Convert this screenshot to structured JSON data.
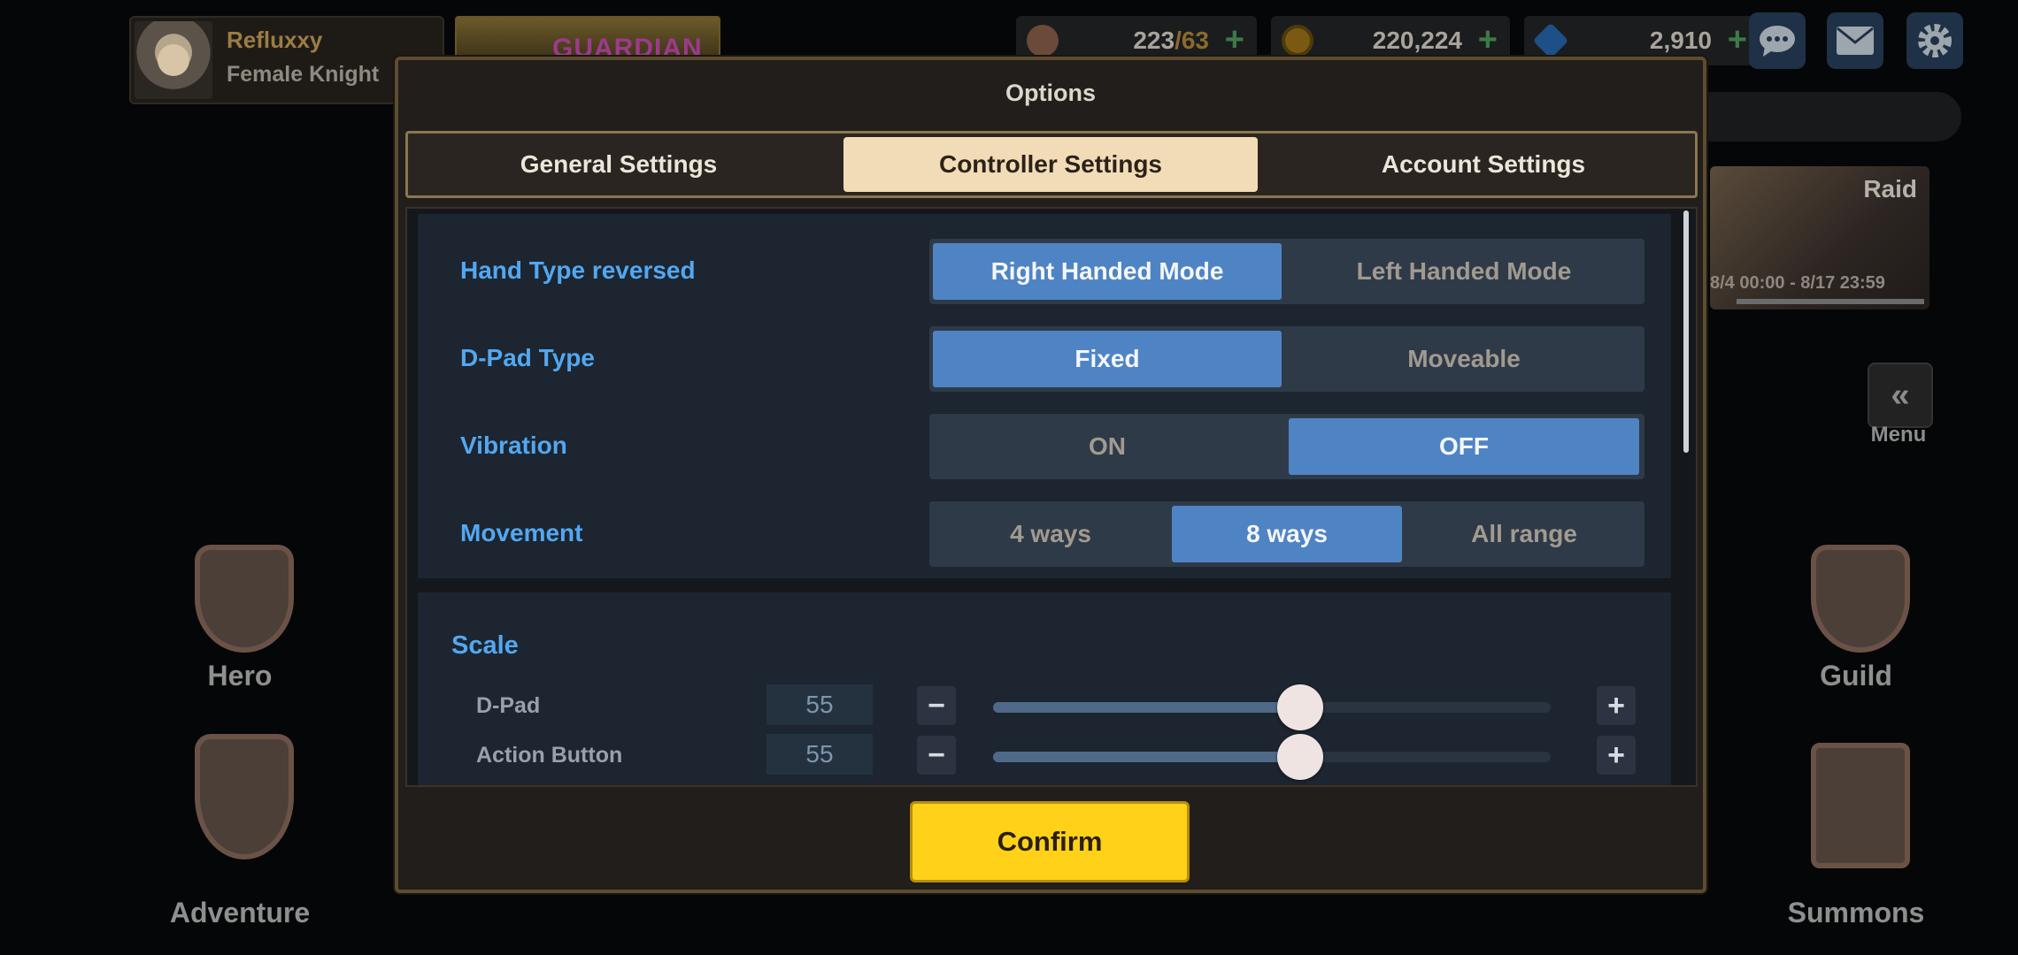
{
  "profile": {
    "name": "Refluxxy",
    "class": "Female Knight"
  },
  "banner": {
    "text": "GUARDIAN"
  },
  "resources": {
    "stamina": {
      "current": "223",
      "max": "/63",
      "icon": "coffee-cup-icon"
    },
    "gold": {
      "value": "220,224",
      "icon": "gold-coin-icon"
    },
    "gems": {
      "value": "2,910",
      "icon": "gem-icon"
    }
  },
  "raid": {
    "title": "Raid",
    "date": "8/4 00:00 - 8/17 23:59"
  },
  "menu": {
    "label": "Menu"
  },
  "nav": {
    "hero": "Hero",
    "adventure": "Adventure",
    "guild": "Guild",
    "summons": "Summons"
  },
  "options": {
    "title": "Options",
    "tabs": [
      "General Settings",
      "Controller Settings",
      "Account Settings"
    ],
    "active_tab": 1,
    "rows": [
      {
        "label": "Hand Type reversed",
        "options": [
          "Right Handed Mode",
          "Left Handed Mode"
        ],
        "selected": 0
      },
      {
        "label": "D-Pad Type",
        "options": [
          "Fixed",
          "Moveable"
        ],
        "selected": 0
      },
      {
        "label": "Vibration",
        "options": [
          "ON",
          "OFF"
        ],
        "selected": 1
      },
      {
        "label": "Movement",
        "options": [
          "4 ways",
          "8 ways",
          "All range"
        ],
        "selected": 1
      }
    ],
    "scale": {
      "title": "Scale",
      "sliders": [
        {
          "label": "D-Pad",
          "value": "55",
          "fraction": 0.55
        },
        {
          "label": "Action Button",
          "value": "55",
          "fraction": 0.55
        }
      ],
      "minus": "−",
      "plus": "+"
    },
    "confirm": "Confirm"
  },
  "colors": {
    "accent_blue": "#53a7f0",
    "selected_option": "#4f84c4",
    "confirm_yellow": "#ffd219",
    "active_tab": "#f2dcb7"
  }
}
